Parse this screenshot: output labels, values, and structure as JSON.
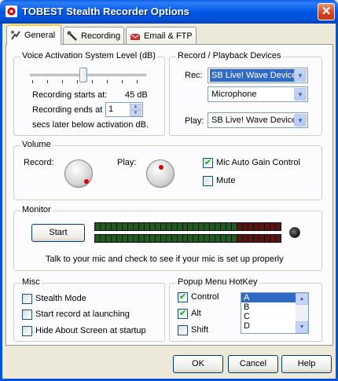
{
  "window": {
    "title": "TOBEST Stealth Recorder Options",
    "close_icon": "close-icon"
  },
  "tabs": [
    {
      "label": "General",
      "icon": "general-settings-icon"
    },
    {
      "label": "Recording",
      "icon": "recording-icon"
    },
    {
      "label": "Email & FTP",
      "icon": "email-ftp-icon"
    }
  ],
  "vas": {
    "label": "Voice Activation System Level (dB)",
    "starts_text": "Recording starts at:",
    "starts_value": "45 dB",
    "ends_text": "Recording ends at",
    "ends_value": "1",
    "secs_text": "secs later below activation dB."
  },
  "devices": {
    "label": "Record / Playback Devices",
    "rec_label": "Rec:",
    "rec_device": "SB Live! Wave Device",
    "rec_line": "Microphone",
    "play_label": "Play:",
    "play_device": "SB Live! Wave Device"
  },
  "volume": {
    "label": "Volume",
    "record_label": "Record:",
    "play_label": "Play:",
    "mic_agc_label": "Mic Auto Gain Control",
    "mic_agc_checked": true,
    "mute_label": "Mute",
    "mute_checked": false
  },
  "monitor": {
    "label": "Monitor",
    "start_label": "Start",
    "hint": "Talk to your mic and check to see if your mic is set up properly"
  },
  "misc": {
    "label": "Misc",
    "stealth_mode": "Stealth Mode",
    "start_record": "Start record at launching",
    "hide_about": "Hide About Screen at startup"
  },
  "hotkey": {
    "label": "Popup Menu HotKey",
    "control_label": "Control",
    "alt_label": "Alt",
    "shift_label": "Shift",
    "keys": [
      "A",
      "B",
      "C",
      "D"
    ],
    "selected_key": "A"
  },
  "buttons": {
    "ok": "OK",
    "cancel": "Cancel",
    "help": "Help"
  },
  "colors": {
    "titlebar": "#0058e6",
    "accent_tab": "#ffc83c",
    "selection": "#316ac5",
    "meter_green": "#2f9a2f",
    "meter_red": "#8a1c1c"
  }
}
